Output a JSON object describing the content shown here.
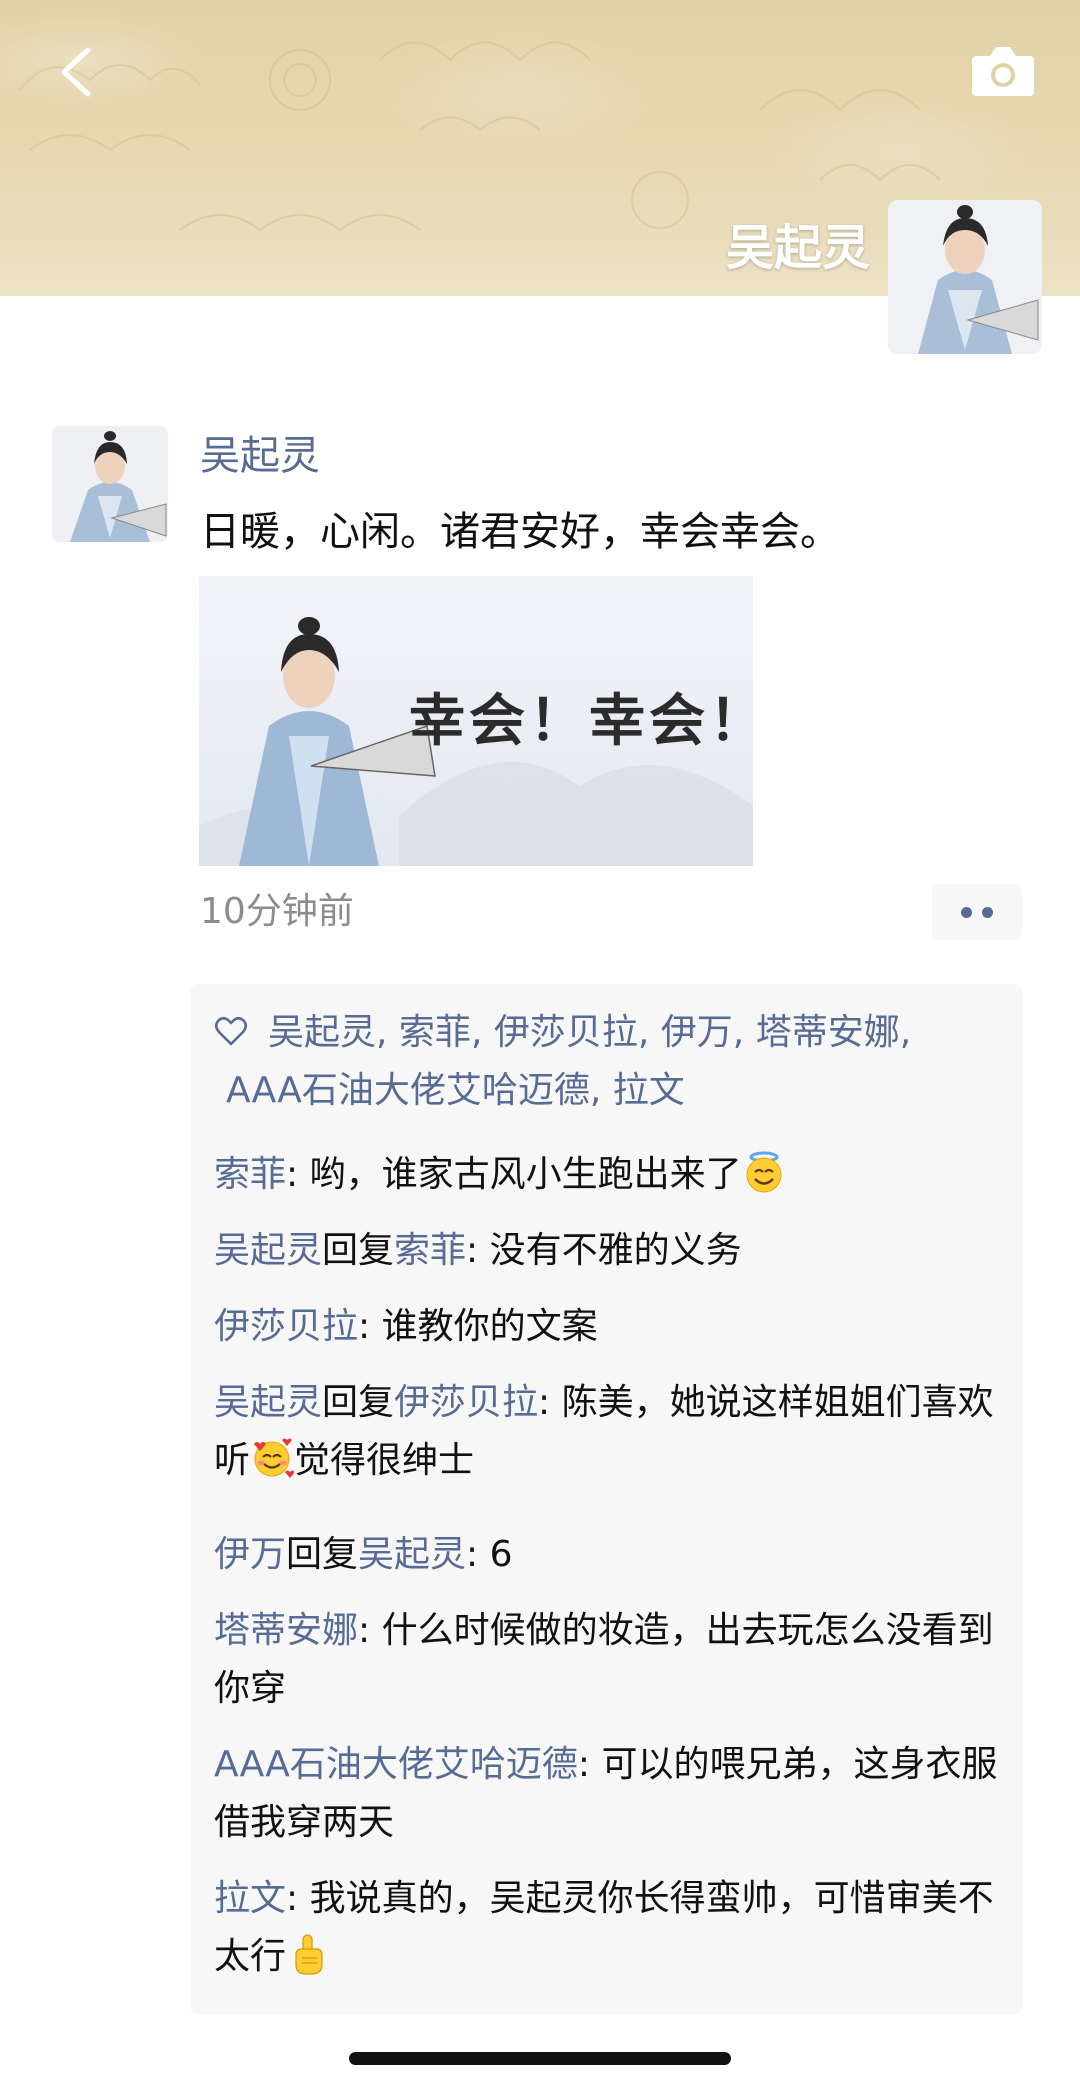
{
  "header": {
    "back_icon": "chevron-left-icon",
    "camera_icon": "camera-icon",
    "profile_name": "吴起灵"
  },
  "post": {
    "author": "吴起灵",
    "text": "日暖，心闲。诸君安好，幸会幸会。",
    "image_caption": "幸会！幸会！",
    "time": "10分钟前",
    "more_icon": "more-dots-icon"
  },
  "likes": {
    "icon": "heart-icon",
    "names": [
      "吴起灵",
      "索菲",
      "伊莎贝拉",
      "伊万",
      "塔蒂安娜",
      "AAA石油大佬艾哈迈德",
      "拉文"
    ],
    "separator": ","
  },
  "comments": [
    {
      "author": "索菲",
      "reply_word": "",
      "reply_to": "",
      "colon": ":",
      "text": " 哟，谁家古风小生跑出来了",
      "emoji": "halo-smile-emoji"
    },
    {
      "author": "吴起灵",
      "reply_word": "回复",
      "reply_to": "索菲",
      "colon": ":",
      "text": " 没有不雅的义务",
      "emoji": ""
    },
    {
      "author": "伊莎贝拉",
      "reply_word": "",
      "reply_to": "",
      "colon": ":",
      "text": " 谁教你的文案",
      "emoji": ""
    },
    {
      "author": "吴起灵",
      "reply_word": "回复",
      "reply_to": "伊莎贝拉",
      "colon": ":",
      "text": " 陈美，她说这样姐姐们喜欢听",
      "emoji": "smiling-hearts-emoji",
      "text_after": "觉得很绅士"
    },
    {
      "author": "伊万",
      "reply_word": "回复",
      "reply_to": "吴起灵",
      "colon": ":",
      "text": " 6",
      "emoji": ""
    },
    {
      "author": "塔蒂安娜",
      "reply_word": "",
      "reply_to": "",
      "colon": ":",
      "text": " 什么时候做的妆造，出去玩怎么没看到你穿",
      "emoji": ""
    },
    {
      "author": "AAA石油大佬艾哈迈德",
      "reply_word": "",
      "reply_to": "",
      "colon": ":",
      "text": " 可以的喂兄弟，这身衣服借我穿两天",
      "emoji": ""
    },
    {
      "author": "拉文",
      "reply_word": "",
      "reply_to": "",
      "colon": ":",
      "text": " 我说真的，吴起灵你长得蛮帅，可惜审美不太行",
      "emoji": "pointing-up-emoji"
    }
  ],
  "colors": {
    "link_blue": "#576b95",
    "cover_gold": "#e3d5ac",
    "comment_bg": "#f7f7f7"
  }
}
